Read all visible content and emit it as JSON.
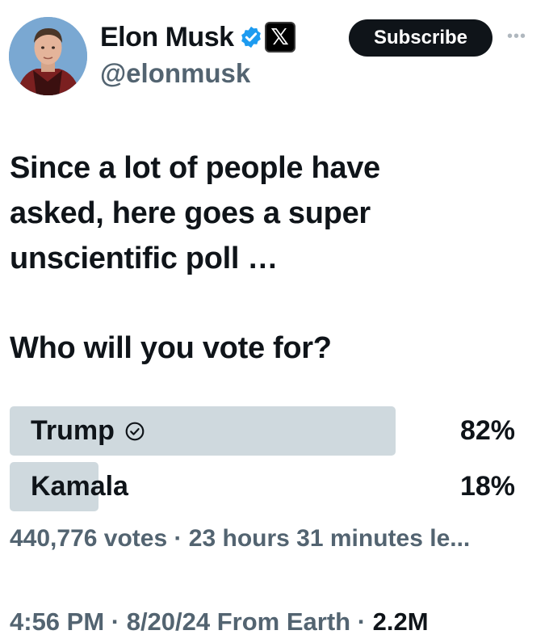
{
  "author": {
    "display_name": "Elon Musk",
    "handle": "@elonmusk",
    "verified_icon": "verified-badge-icon",
    "affiliate_icon": "x-logo-icon",
    "avatar": "profile-photo"
  },
  "subscribe_label": "Subscribe",
  "more_icon": "more-horizontal-icon",
  "tweet": {
    "lines": [
      "Since a lot of people have",
      "asked, here goes a super",
      "unscientific poll …"
    ],
    "question": "Who will you vote for?"
  },
  "poll": {
    "options": [
      {
        "label": "Trump",
        "percent_text": "82%",
        "fraction": 0.82,
        "selected": true
      },
      {
        "label": "Kamala",
        "percent_text": "18%",
        "fraction": 0.18,
        "selected": false
      }
    ],
    "meta": "440,776 votes · 23 hours 31 minutes le..."
  },
  "footer": {
    "time_date": "4:56 PM · 8/20/24 From Earth · ",
    "views": "2.2M"
  },
  "colors": {
    "text": "#0f1419",
    "secondary": "#536471",
    "poll_bar": "#cfd9de",
    "verified": "#1d9bf0",
    "button": "#0f1419"
  }
}
